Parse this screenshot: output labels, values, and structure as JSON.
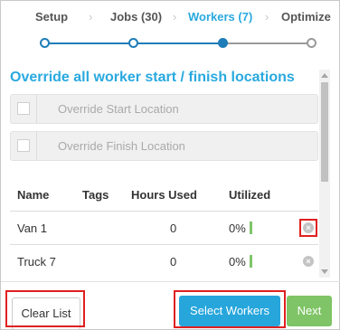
{
  "steps": [
    {
      "label": "Setup",
      "state": "done"
    },
    {
      "label": "Jobs (30)",
      "state": "done"
    },
    {
      "label": "Workers (7)",
      "state": "active"
    },
    {
      "label": "Optimize",
      "state": "todo"
    }
  ],
  "heading": "Override all worker start / finish locations",
  "overrides": {
    "start_label": "Override Start Location",
    "finish_label": "Override Finish Location"
  },
  "table": {
    "columns": [
      "Name",
      "Tags",
      "Hours Used",
      "Utilized"
    ],
    "rows": [
      {
        "name": "Van 1",
        "tags": "",
        "hours": "0",
        "utilized": "0%"
      },
      {
        "name": "Truck 7",
        "tags": "",
        "hours": "0",
        "utilized": "0%"
      }
    ]
  },
  "footer": {
    "clear_label": "Clear List",
    "select_label": "Select Workers",
    "next_label": "Next"
  },
  "colors": {
    "accent": "#29a9df",
    "step_done": "#1e7db8",
    "next": "#7fc466",
    "highlight": "#e02020"
  }
}
